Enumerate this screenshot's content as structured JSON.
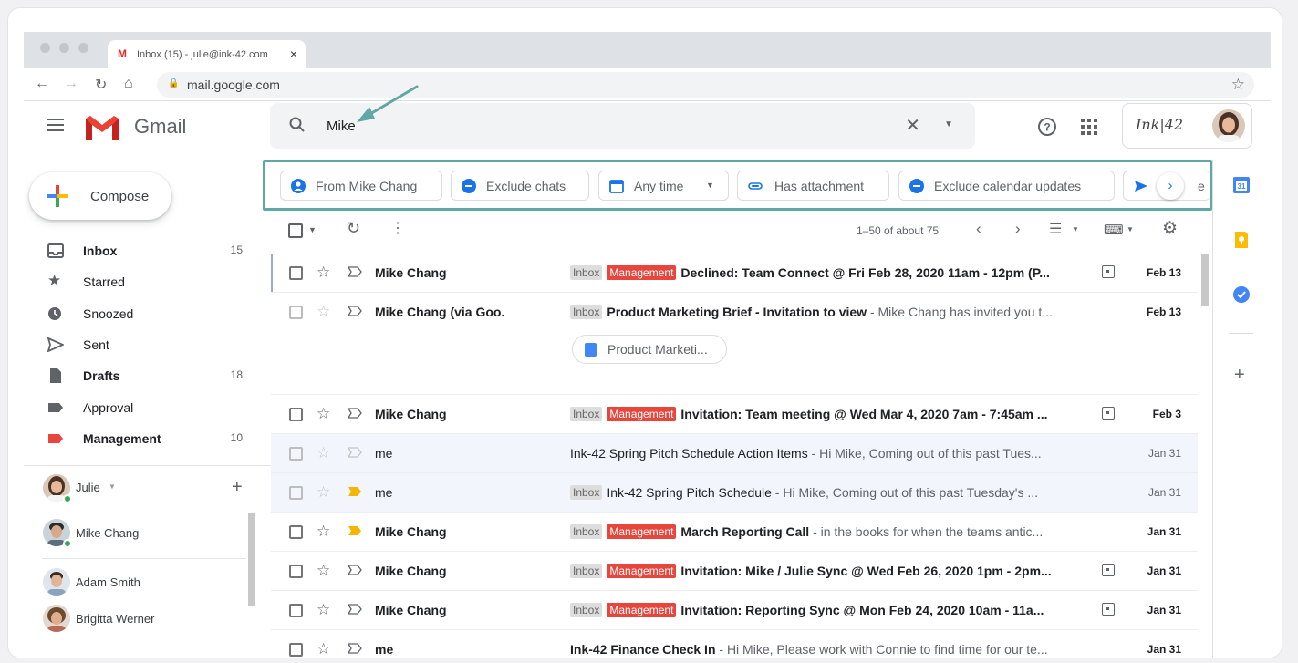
{
  "browser": {
    "tab_title": "Inbox (15) - julie@ink-42.com",
    "url": "mail.google.com"
  },
  "gmail": {
    "app_name": "Gmail",
    "search_query": "Mike",
    "brand_text": "Ink​|42"
  },
  "chips": [
    {
      "label": "From Mike Chang",
      "icon": "person-icon"
    },
    {
      "label": "Exclude chats",
      "icon": "minus-circle-icon"
    },
    {
      "label": "Any time",
      "icon": "calendar-icon"
    },
    {
      "label": "Has attachment",
      "icon": "attachment-icon"
    },
    {
      "label": "Exclude calendar updates",
      "icon": "minus-circle-icon"
    },
    {
      "label": "e",
      "icon": "send-icon"
    }
  ],
  "toolbar": {
    "pagination": "1–50 of about 75"
  },
  "sidebar": {
    "compose_label": "Compose",
    "items": [
      {
        "label": "Inbox",
        "count": "15",
        "icon": "inbox-icon",
        "bold": true
      },
      {
        "label": "Starred",
        "count": "",
        "icon": "star-icon"
      },
      {
        "label": "Snoozed",
        "count": "",
        "icon": "clock-icon"
      },
      {
        "label": "Sent",
        "count": "",
        "icon": "send-icon"
      },
      {
        "label": "Drafts",
        "count": "18",
        "icon": "draft-icon",
        "bold": true
      },
      {
        "label": "Approval",
        "count": "",
        "icon": "label-icon"
      },
      {
        "label": "Management",
        "count": "10",
        "icon": "label-icon",
        "bold": true,
        "color": "#e8453c"
      }
    ]
  },
  "hangouts": {
    "user": "Julie",
    "contacts": [
      "Mike Chang",
      "Adam Smith",
      "Brigitta Werner"
    ]
  },
  "emails": [
    {
      "from": "Mike Chang",
      "labels": [
        "Inbox",
        "Management"
      ],
      "subject": "Declined: Team Connect @ Fri Feb 28, 2020 11am - 12pm (P...",
      "snippet": "",
      "date": "Feb 13",
      "unread": true,
      "calendar": true,
      "important": false
    },
    {
      "from": "Mike Chang (via Goo.",
      "labels": [
        "Inbox"
      ],
      "subject": "Product Marketing Brief - Invitation to view",
      "snippet": " - Mike Chang has invited you t...",
      "date": "Feb 13",
      "unread": true,
      "calendar": false,
      "important": false,
      "attachment": "Product Marketi..."
    },
    {
      "from": "Mike Chang",
      "labels": [
        "Inbox",
        "Management"
      ],
      "subject": "Invitation: Team meeting @ Wed Mar 4, 2020 7am - 7:45am ...",
      "snippet": "",
      "date": "Feb 3",
      "unread": true,
      "calendar": true,
      "important": false
    },
    {
      "from": "me",
      "labels": [],
      "subject": "Ink-42 Spring Pitch Schedule Action Items",
      "snippet": " - Hi Mike, Coming out of this past Tues...",
      "date": "Jan 31",
      "unread": false,
      "calendar": false,
      "important": false
    },
    {
      "from": "me",
      "labels": [
        "Inbox"
      ],
      "subject": "Ink-42 Spring Pitch Schedule",
      "snippet": " - Hi Mike, Coming out of this past Tuesday's ...",
      "date": "Jan 31",
      "unread": false,
      "calendar": false,
      "important": true
    },
    {
      "from": "Mike Chang",
      "labels": [
        "Inbox",
        "Management"
      ],
      "subject": "March Reporting Call",
      "snippet": " - in the books for when the teams antic...",
      "date": "Jan 31",
      "unread": true,
      "calendar": false,
      "important": true
    },
    {
      "from": "Mike Chang",
      "labels": [
        "Inbox",
        "Management"
      ],
      "subject": "Invitation: Mike / Julie Sync @ Wed Feb 26, 2020 1pm - 2pm...",
      "snippet": "",
      "date": "Jan 31",
      "unread": true,
      "calendar": true,
      "important": false
    },
    {
      "from": "Mike Chang",
      "labels": [
        "Inbox",
        "Management"
      ],
      "subject": "Invitation: Reporting Sync @ Mon Feb 24, 2020 10am - 11a...",
      "snippet": "",
      "date": "Jan 31",
      "unread": true,
      "calendar": true,
      "important": false
    },
    {
      "from": "me",
      "labels": [],
      "subject": "Ink-42 Finance Check In",
      "snippet": " - Hi Mike, Please work with Connie to find time for our te...",
      "date": "Jan 31",
      "unread": true,
      "calendar": false,
      "important": false
    }
  ],
  "colors": {
    "highlight_border": "#5fa8a5",
    "management_label": "#e8453c",
    "accent_blue": "#1a73e8"
  }
}
